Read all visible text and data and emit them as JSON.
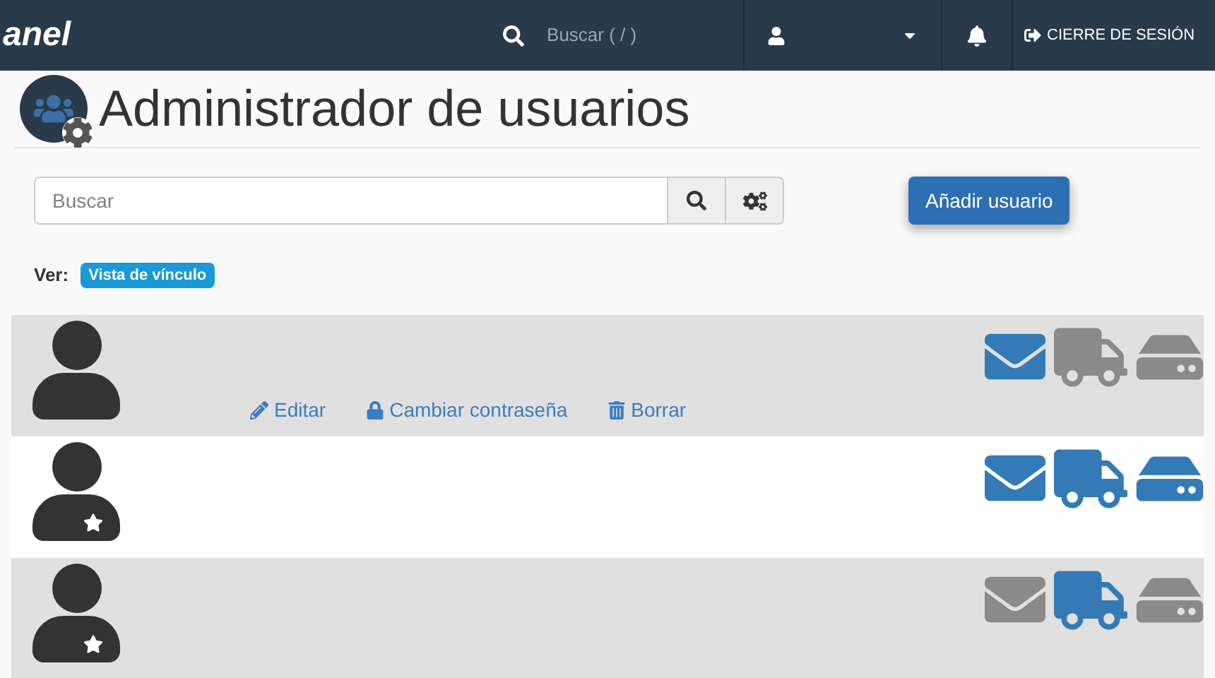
{
  "topbar": {
    "logo": "anel",
    "search_placeholder": "Buscar ( / )",
    "logout": "CIERRE DE SESIÓN"
  },
  "title": "Administrador de usuarios",
  "search": {
    "placeholder": "Buscar"
  },
  "add_button": "Añadir usuario",
  "view": {
    "label": "Ver:",
    "badge": "Vista de vínculo"
  },
  "users": [
    {
      "subaccount": false,
      "email": true,
      "ftp": false,
      "webdisk": false,
      "actions": [
        "Editar",
        "Cambiar contraseña",
        "Borrar"
      ]
    },
    {
      "subaccount": true,
      "email": true,
      "ftp": true,
      "webdisk": true
    },
    {
      "subaccount": true,
      "email": false,
      "ftp": true,
      "webdisk": false
    }
  ]
}
